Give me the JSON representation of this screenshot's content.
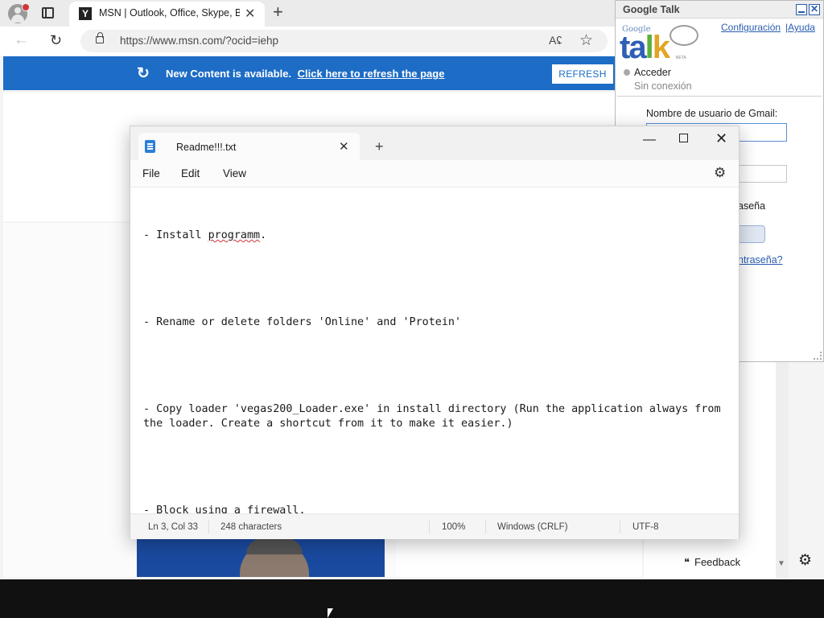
{
  "browser": {
    "tab_title": "MSN | Outlook, Office, Skype, Bing",
    "url": "https://www.msn.com/?ocid=iehp",
    "read_aloud_icon": "Aʢ",
    "banner": {
      "message": "New Content is available.",
      "link": "Click here to refresh the page",
      "button": "REFRESH"
    },
    "feedback_label": "Feedback"
  },
  "gtalk": {
    "title": "Google Talk",
    "logo_small": "Google",
    "logo_word": "talk",
    "logo_beta": "BETA",
    "config_link": "Configuración",
    "help_separator": "|",
    "help_link": "Ayuda",
    "status": "Acceder",
    "status_sub": "Sin conexión",
    "username_label": "Nombre de usuario de Gmail:",
    "password_label_fragment": "aseña",
    "forgot_fragment": "ntraseña?"
  },
  "notepad": {
    "tab_title": "Readme!!!.txt",
    "menu": {
      "file": "File",
      "edit": "Edit",
      "view": "View"
    },
    "lines": {
      "l1_prefix": "- Install ",
      "l1_word": "programm",
      "l1_suffix": ".",
      "l2": "- Rename or delete folders 'Online' and 'Protein'",
      "l3": "- Copy loader 'vegas200_Loader.exe' in install directory (Run the application always from the loader. Create a shortcut from it to make it easier.)",
      "l4": "- Block using a firewall."
    },
    "status": {
      "position": "Ln 3, Col 33",
      "chars": "248 characters",
      "zoom": "100%",
      "line_ending": "Windows (CRLF)",
      "encoding": "UTF-8"
    }
  },
  "icons": {
    "tab_close": "✕",
    "new_tab": "+",
    "back": "←",
    "reload": "↻",
    "star": "☆",
    "minimize": "—",
    "close": "✕",
    "gear": "⚙",
    "chevron_down": "▼",
    "feedback": "❝"
  },
  "colors": {
    "banner": "#1d6cc6",
    "notepad_icon": "#2c7fd6",
    "link": "#2a5db0"
  }
}
